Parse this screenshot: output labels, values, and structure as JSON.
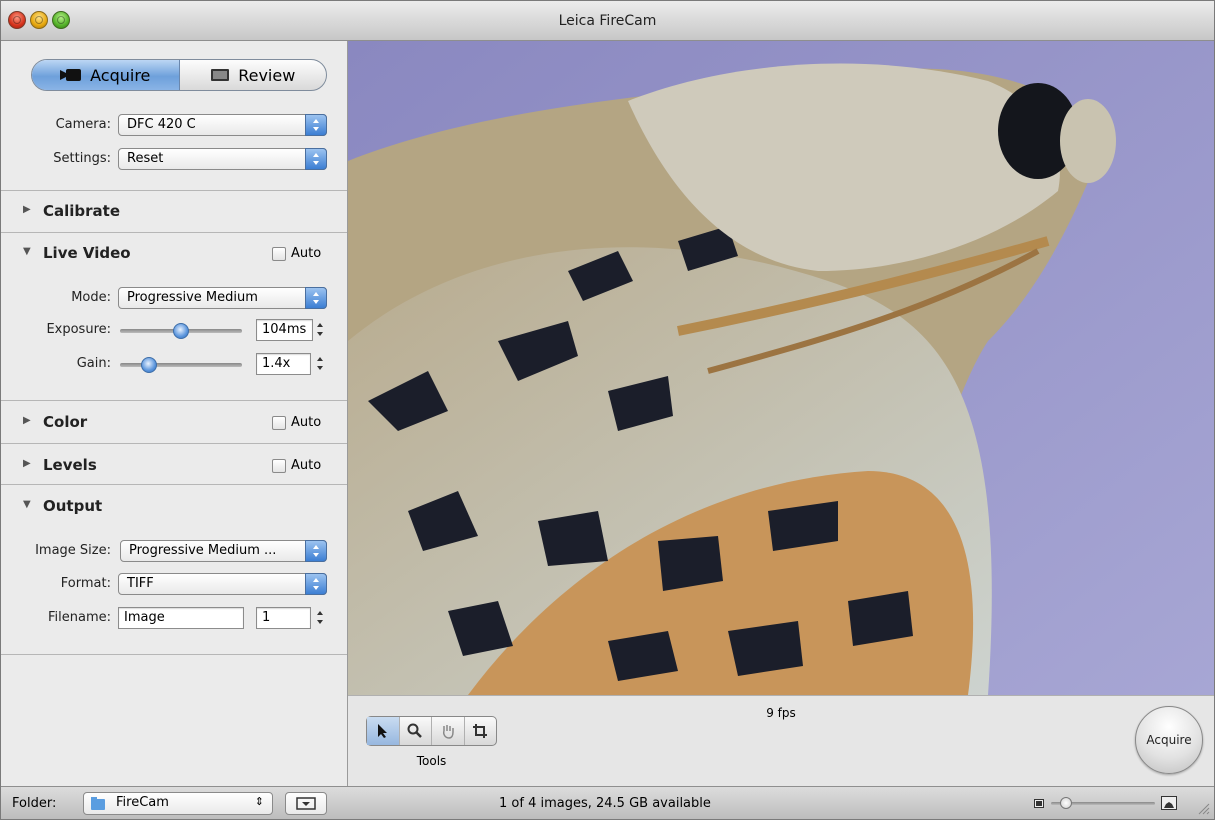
{
  "window": {
    "title": "Leica FireCam"
  },
  "mode_switch": {
    "acquire": "Acquire",
    "review": "Review",
    "selected": "Acquire"
  },
  "camera": {
    "label": "Camera:",
    "value": "DFC 420 C"
  },
  "settings": {
    "label": "Settings:",
    "value": "Reset"
  },
  "sections": {
    "calibrate": {
      "title": "Calibrate",
      "expanded": false
    },
    "live_video": {
      "title": "Live Video",
      "expanded": true,
      "auto_label": "Auto",
      "auto": false,
      "mode_label": "Mode:",
      "mode_value": "Progressive Medium",
      "exposure_label": "Exposure:",
      "exposure_value": "104ms",
      "exposure_level": 0.5,
      "gain_label": "Gain:",
      "gain_value": "1.4x",
      "gain_level": 0.2
    },
    "color": {
      "title": "Color",
      "expanded": false,
      "auto_label": "Auto",
      "auto": false
    },
    "levels": {
      "title": "Levels",
      "expanded": false,
      "auto_label": "Auto",
      "auto": false
    },
    "output": {
      "title": "Output",
      "expanded": true,
      "image_size_label": "Image Size:",
      "image_size_value": "Progressive Medium ...",
      "format_label": "Format:",
      "format_value": "TIFF",
      "filename_label": "Filename:",
      "filename_value": "Image",
      "counter_value": "1"
    }
  },
  "viewer": {
    "fps": "9 fps",
    "tools_label": "Tools",
    "tools": [
      "arrow-icon",
      "zoom-icon",
      "hand-icon",
      "crop-icon"
    ],
    "selected_tool": "arrow-icon",
    "acquire_label": "Acquire"
  },
  "status": {
    "folder_label": "Folder:",
    "folder_value": "FireCam",
    "message": "1 of 4 images, 24.5 GB available",
    "zoom_level": 0.1
  }
}
